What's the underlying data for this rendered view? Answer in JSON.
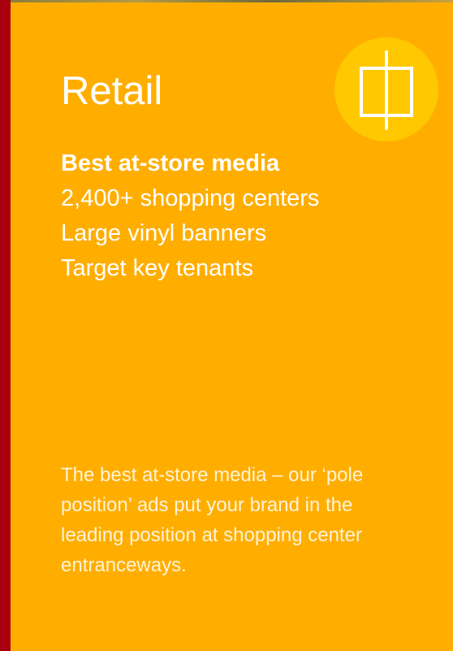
{
  "card": {
    "title": "Retail",
    "icon": "pole-banner-icon",
    "features": [
      "Best at-store media",
      "2,400+ shopping centers",
      "Large vinyl banners",
      "Target key tenants"
    ],
    "description": "The best at-store media – our ‘pole position’ ads put your brand in the leading position at shopping center entranceways."
  },
  "colors": {
    "background": "#ffae00",
    "accent": "#a8000f",
    "icon_circle": "#ffc800",
    "text": "#ffffff"
  }
}
